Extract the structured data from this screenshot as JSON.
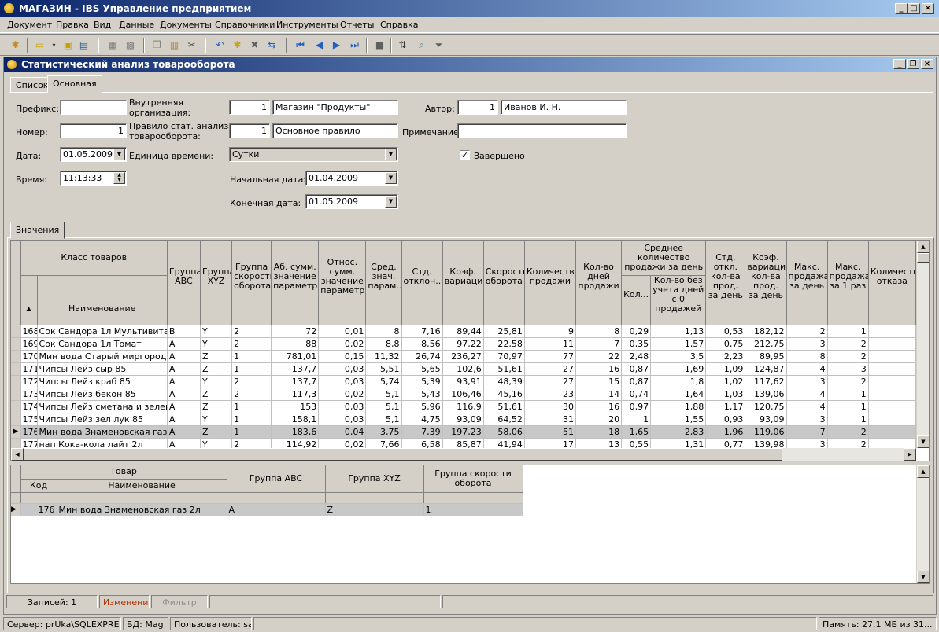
{
  "app": {
    "title": "МАГАЗИН - IBS Управление предприятием"
  },
  "menu": [
    "Документ",
    "Правка",
    "Вид",
    "Данные",
    "Документы",
    "Справочники",
    "Инструменты",
    "Отчеты",
    "Справка"
  ],
  "window": {
    "title": "Статистический анализ товарооборота"
  },
  "tabs": [
    "Список",
    "Основная"
  ],
  "form": {
    "prefix_label": "Префикс:",
    "prefix_value": "",
    "number_label": "Номер:",
    "number_value": "1",
    "date_label": "Дата:",
    "date_value": "01.05.2009",
    "time_label": "Время:",
    "time_value": "11:13:33",
    "org_label_1": "Внутренняя",
    "org_label_2": "организация:",
    "org_code": "1",
    "org_name": "Магазин \"Продукты\"",
    "rule_label_1": "Правило стат. анализа",
    "rule_label_2": "товарооборота:",
    "rule_code": "1",
    "rule_name": "Основное правило",
    "unit_label": "Единица времени:",
    "unit_value": "Сутки",
    "start_label": "Начальная дата:",
    "start_value": "01.04.2009",
    "end_label": "Конечная дата:",
    "end_value": "01.05.2009",
    "author_label": "Автор:",
    "author_code": "1",
    "author_name": "Иванов И. Н.",
    "note_label": "Примечание:",
    "note_value": "",
    "done_label": "Завершено",
    "done_checked": true
  },
  "values_tab": "Значения",
  "grid": {
    "header": {
      "class_group": "Класс товаров",
      "name": "Наименование",
      "abc": "Группа ABC",
      "xyz": "Группа XYZ",
      "speed": "Группа скорости оборота",
      "abs_sum": "Аб. сумм. значение параметра",
      "rel_sum": "Относ. сумм. значение параметра",
      "avg": "Сред. знач. парам...",
      "std": "Стд. отклон...",
      "coef": "Коэф. вариации",
      "turnover": "Скорость оборота",
      "sales_count": "Количество продажи",
      "days": "Кол-во дней продажи",
      "avg_day_group": "Среднее количество продажи за день",
      "avg_day": "Кол...",
      "avg_day_no0": "Кол-во без учета дней с 0 продажей",
      "std_day": "Стд. откл. кол-ва прод. за день",
      "coef_day": "Коэф. вариации кол-ва прод. за день",
      "max_day": "Макс. продажа за день",
      "max_once": "Макс. продажа за 1 раз",
      "refuse": "Количество отказа"
    },
    "rows": [
      [
        "168",
        "Сок Сандора 1л Мультивита...",
        "B",
        "Y",
        "2",
        "72",
        "0,01",
        "8",
        "7,16",
        "89,44",
        "25,81",
        "9",
        "8",
        "0,29",
        "1,13",
        "0,53",
        "182,12",
        "2",
        "1"
      ],
      [
        "169",
        "Сок Сандора 1л Томат",
        "A",
        "Y",
        "2",
        "88",
        "0,02",
        "8,8",
        "8,56",
        "97,22",
        "22,58",
        "11",
        "7",
        "0,35",
        "1,57",
        "0,75",
        "212,75",
        "3",
        "2"
      ],
      [
        "170",
        "Мин вода Старый миргород 6л",
        "A",
        "Z",
        "1",
        "781,01",
        "0,15",
        "11,32",
        "26,74",
        "236,27",
        "70,97",
        "77",
        "22",
        "2,48",
        "3,5",
        "2,23",
        "89,95",
        "8",
        "2"
      ],
      [
        "171",
        "Чипсы Лейз сыр 85",
        "A",
        "Z",
        "1",
        "137,7",
        "0,03",
        "5,51",
        "5,65",
        "102,6",
        "51,61",
        "27",
        "16",
        "0,87",
        "1,69",
        "1,09",
        "124,87",
        "4",
        "3"
      ],
      [
        "172",
        "Чипсы Лейз краб 85",
        "A",
        "Y",
        "2",
        "137,7",
        "0,03",
        "5,74",
        "5,39",
        "93,91",
        "48,39",
        "27",
        "15",
        "0,87",
        "1,8",
        "1,02",
        "117,62",
        "3",
        "2"
      ],
      [
        "173",
        "Чипсы Лейз бекон 85",
        "A",
        "Z",
        "2",
        "117,3",
        "0,02",
        "5,1",
        "5,43",
        "106,46",
        "45,16",
        "23",
        "14",
        "0,74",
        "1,64",
        "1,03",
        "139,06",
        "4",
        "1"
      ],
      [
        "174",
        "Чипсы Лейз сметана и зелень...",
        "A",
        "Z",
        "1",
        "153",
        "0,03",
        "5,1",
        "5,96",
        "116,9",
        "51,61",
        "30",
        "16",
        "0,97",
        "1,88",
        "1,17",
        "120,75",
        "4",
        "1"
      ],
      [
        "175",
        "Чипсы Лейз зел лук 85",
        "A",
        "Y",
        "1",
        "158,1",
        "0,03",
        "5,1",
        "4,75",
        "93,09",
        "64,52",
        "31",
        "20",
        "1",
        "1,55",
        "0,93",
        "93,09",
        "3",
        "1"
      ],
      [
        "176",
        "Мин вода Знаменовская газ 2л",
        "A",
        "Z",
        "1",
        "183,6",
        "0,04",
        "3,75",
        "7,39",
        "197,23",
        "58,06",
        "51",
        "18",
        "1,65",
        "2,83",
        "1,96",
        "119,06",
        "7",
        "2"
      ],
      [
        "177",
        "нап Кока-кола лайт 2л",
        "A",
        "Y",
        "2",
        "114,92",
        "0,02",
        "7,66",
        "6,58",
        "85,87",
        "41,94",
        "17",
        "13",
        "0,55",
        "1,31",
        "0,77",
        "139,98",
        "3",
        "2"
      ]
    ],
    "selected_index": 8
  },
  "detail": {
    "header": {
      "goods": "Товар",
      "code": "Код",
      "name": "Наименование",
      "abc": "Группа ABC",
      "xyz": "Группа XYZ",
      "speed": "Группа скорости оборота"
    },
    "row": {
      "code": "176",
      "name": "Мин вода Знаменовская газ 2л",
      "abc": "A",
      "xyz": "Z",
      "speed": "1"
    }
  },
  "status": {
    "records": "Записей: 1",
    "change": "Изменение",
    "filter": "Фильтр",
    "server": "Сервер: prUka\\SQLEXPRESS",
    "db": "БД: Mag",
    "user": "Пользователь: sa",
    "memory": "Память: 27,1 МБ из 31..."
  },
  "colors": {
    "title_start": "#0a246a",
    "title_end": "#a6caf0",
    "selected_row": "#c8c8c8",
    "change_text": "#b03000"
  }
}
